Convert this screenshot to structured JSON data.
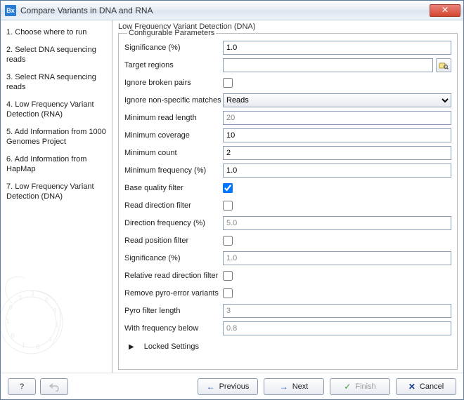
{
  "window": {
    "title": "Compare Variants in DNA and RNA",
    "app_icon_text": "Bx"
  },
  "sidebar": {
    "steps": [
      "Choose where to run",
      "Select DNA sequencing reads",
      "Select RNA sequencing reads",
      "Low Frequency Variant Detection (RNA)",
      "Add Information from 1000 Genomes Project",
      "Add Information from HapMap",
      "Low Frequency Variant Detection (DNA)"
    ]
  },
  "content": {
    "header": "Low Frequency Variant Detection (DNA)",
    "legend": "Configurable Parameters",
    "params": {
      "significance": {
        "label": "Significance (%)",
        "value": "1.0"
      },
      "target_regions": {
        "label": "Target regions",
        "value": ""
      },
      "ignore_broken_pairs": {
        "label": "Ignore broken pairs",
        "checked": false
      },
      "ignore_nonspecific": {
        "label": "Ignore non-specific matches",
        "value": "Reads"
      },
      "min_read_length": {
        "label": "Minimum read length",
        "value": "20",
        "disabled": true
      },
      "min_coverage": {
        "label": "Minimum coverage",
        "value": "10"
      },
      "min_count": {
        "label": "Minimum count",
        "value": "2"
      },
      "min_frequency": {
        "label": "Minimum frequency (%)",
        "value": "1.0"
      },
      "base_quality_filter": {
        "label": "Base quality filter",
        "checked": true
      },
      "read_direction_filter": {
        "label": "Read direction filter",
        "checked": false
      },
      "direction_frequency": {
        "label": "Direction frequency (%)",
        "value": "5.0",
        "disabled": true
      },
      "read_position_filter": {
        "label": "Read position filter",
        "checked": false
      },
      "significance2": {
        "label": "Significance (%)",
        "value": "1.0",
        "disabled": true
      },
      "relative_read_direction": {
        "label": "Relative read direction filter",
        "checked": false
      },
      "remove_pyro": {
        "label": "Remove pyro-error variants",
        "checked": false
      },
      "pyro_filter_length": {
        "label": "Pyro filter length",
        "value": "3",
        "disabled": true
      },
      "with_freq_below": {
        "label": "With frequency below",
        "value": "0.8",
        "disabled": true
      }
    },
    "locked": "Locked Settings"
  },
  "footer": {
    "help": "?",
    "previous": "Previous",
    "next": "Next",
    "finish": "Finish",
    "cancel": "Cancel"
  }
}
